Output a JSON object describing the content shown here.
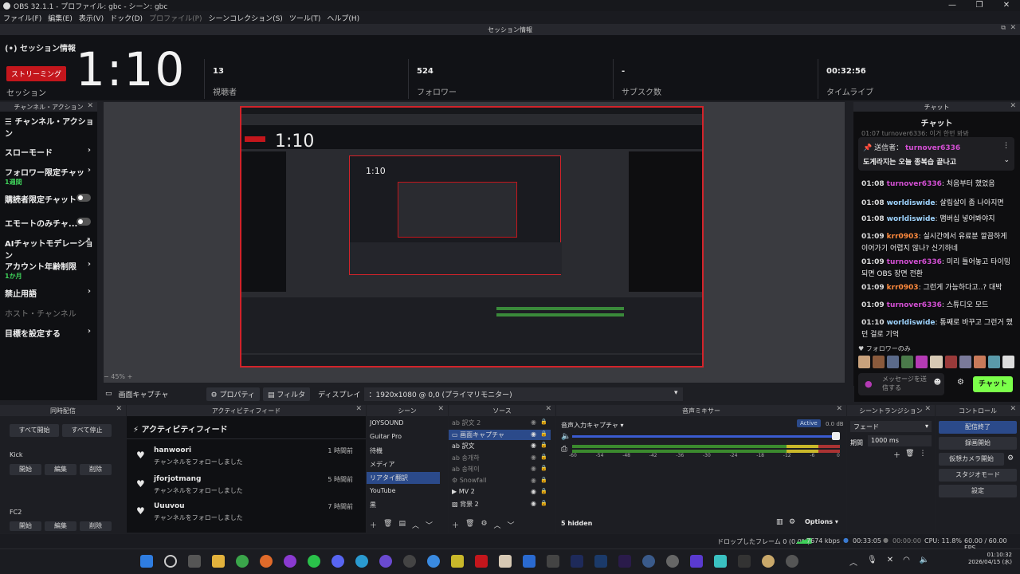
{
  "window": {
    "title": "OBS 32.1.1 - プロファイル: gbc - シーン: gbc"
  },
  "menu": [
    "ファイル(F)",
    "編集(E)",
    "表示(V)",
    "ドック(D)",
    "プロファイル(P)",
    "シーンコレクション(S)",
    "ツール(T)",
    "ヘルプ(H)"
  ],
  "session": {
    "dock_title": "セッション情報",
    "title": "セッション情報",
    "live_badge": "ストリーミング",
    "timer": "1:10",
    "timer_label": "セッション",
    "stats": [
      {
        "value": "13",
        "label": "視聴者"
      },
      {
        "value": "524",
        "label": "フォロワー"
      },
      {
        "value": "-",
        "label": "サブスク数"
      },
      {
        "value": "00:32:56",
        "label": "タイムライブ"
      }
    ]
  },
  "channel_actions": {
    "dock_title": "チャンネル・アクション",
    "title": "チャンネル・アクション",
    "items": [
      {
        "label": "スローモード",
        "control": "chevron"
      },
      {
        "label": "フォロワー限定チャッ",
        "sub": "1週間",
        "control": "chevron"
      },
      {
        "label": "購読者限定チャット",
        "control": "toggle"
      },
      {
        "label": "エモートのみチャ...",
        "control": "toggle"
      },
      {
        "label": "AIチャットモデレーション",
        "control": "external"
      },
      {
        "label": "アカウント年齢制限",
        "sub": "1か月",
        "control": "chevron"
      },
      {
        "label": "禁止用語",
        "control": "chevron"
      },
      {
        "label": "ホスト・チャンネル",
        "control": "none",
        "disabled": true
      },
      {
        "label": "目標を設定する",
        "control": "chevron"
      }
    ]
  },
  "chat": {
    "dock_title": "チャット",
    "header": "チャット",
    "pinned_by": "送信者：",
    "pinned_user": "turnover6336",
    "pinned_text": "도게라지는 오늘 종복습 끝나고",
    "top_partial": "01:07  turnover6336: 이거 한번 봐봐",
    "messages": [
      {
        "time": "01:08",
        "user": "turnover6336",
        "cls": "u1",
        "text": "처음부터 했었음"
      },
      {
        "time": "01:08",
        "user": "worldiswide",
        "cls": "u2",
        "text": "살림살이 좀 나아지면"
      },
      {
        "time": "01:08",
        "user": "worldiswide",
        "cls": "u2",
        "text": "맴버십 넣어봐야지"
      },
      {
        "time": "01:09",
        "user": "krr0903",
        "cls": "u3",
        "text": "실시간에서 유료분 깔끔하게 이어가기 어렵지 않나? 신기하네"
      },
      {
        "time": "01:09",
        "user": "turnover6336",
        "cls": "u1",
        "text": "미리 틀어놓고 타이밍 되면 OBS 장면 전환"
      },
      {
        "time": "01:09",
        "user": "krr0903",
        "cls": "u3",
        "text": "그런게 가능하다고..? 대박"
      },
      {
        "time": "01:09",
        "user": "turnover6336",
        "cls": "u1",
        "text": "스튜디오 모드"
      },
      {
        "time": "01:10",
        "user": "worldiswide",
        "cls": "u2",
        "text": "통째로 바꾸고 그런거 했던 걸로 기억"
      }
    ],
    "followers_only": "フォロワーのみ",
    "input_placeholder": "メッセージを送信する",
    "send_label": "チャット"
  },
  "toolbar": {
    "source_name": "画面キャプチャ",
    "properties": "プロパティ",
    "filters": "フィルタ",
    "display_label": "ディスプレイ",
    "display_value": "：1920x1080 @ 0,0 (プライマリモニター)",
    "zoom": "45%"
  },
  "multistream": {
    "dock_title": "同時配信",
    "start_all": "すべて開始",
    "stop_all": "すべて停止",
    "targets": [
      {
        "name": "Kick",
        "start": "開始",
        "edit": "編集",
        "delete": "削除"
      },
      {
        "name": "FC2",
        "start": "開始",
        "edit": "編集",
        "delete": "削除"
      }
    ]
  },
  "activity": {
    "dock_title": "アクティビティフィード",
    "title": "アクティビティフィード",
    "items": [
      {
        "user": "hanwoori",
        "text": "チャンネルをフォローしました",
        "time": "1 時間前"
      },
      {
        "user": "jforjotmang",
        "text": "チャンネルをフォローしました",
        "time": "5 時間前"
      },
      {
        "user": "Uuuvou",
        "text": "チャンネルをフォローしました",
        "time": "7 時間前"
      }
    ]
  },
  "scenes": {
    "dock_title": "シーン",
    "items": [
      "JOYSOUND",
      "Guitar Pro",
      "待機",
      "メディア",
      "リアタイ翻訳",
      "YouTube",
      "黒"
    ],
    "selected": 4
  },
  "sources": {
    "dock_title": "ソース",
    "items": [
      {
        "name": "訳文 2",
        "icon": "text",
        "dim": true
      },
      {
        "name": "画面キャプチャ",
        "icon": "monitor",
        "dim": false
      },
      {
        "name": "訳文",
        "icon": "text",
        "dim": false
      },
      {
        "name": "송개하",
        "icon": "text",
        "dim": true
      },
      {
        "name": "송헤이",
        "icon": "text",
        "dim": true
      },
      {
        "name": "Snowfall",
        "icon": "gear",
        "dim": true
      },
      {
        "name": "MV 2",
        "icon": "play",
        "dim": false
      },
      {
        "name": "背景 2",
        "icon": "image",
        "dim": false
      }
    ]
  },
  "mixer": {
    "dock_title": "音声ミキサー",
    "track": "音声入力キャプチャ",
    "state": "Active",
    "db": "0.0 dB",
    "scale": [
      "-60",
      "-54",
      "-48",
      "-42",
      "-36",
      "-30",
      "-24",
      "-18",
      "-12",
      "-6",
      "0"
    ],
    "hidden": "5 hidden",
    "options": "Options"
  },
  "transitions": {
    "dock_title": "シーントランジション",
    "type": "フェード",
    "duration_label": "期間",
    "duration": "1000 ms"
  },
  "controls": {
    "dock_title": "コントロール",
    "buttons": [
      "配信終了",
      "録画開始",
      "仮想カメラ開始",
      "スタジオモード",
      "設定"
    ]
  },
  "status": {
    "dropped": "ドロップしたフレーム 0 (0.0%)",
    "bitrate": "7674 kbps",
    "live_time": "00:33:05",
    "rec_time": "00:00:00",
    "cpu": "CPU: 11.8%",
    "fps": "60.00 / 60.00 FPS"
  },
  "taskbar": {
    "time": "01:10:32",
    "date": "2026/04/15 (水)"
  }
}
